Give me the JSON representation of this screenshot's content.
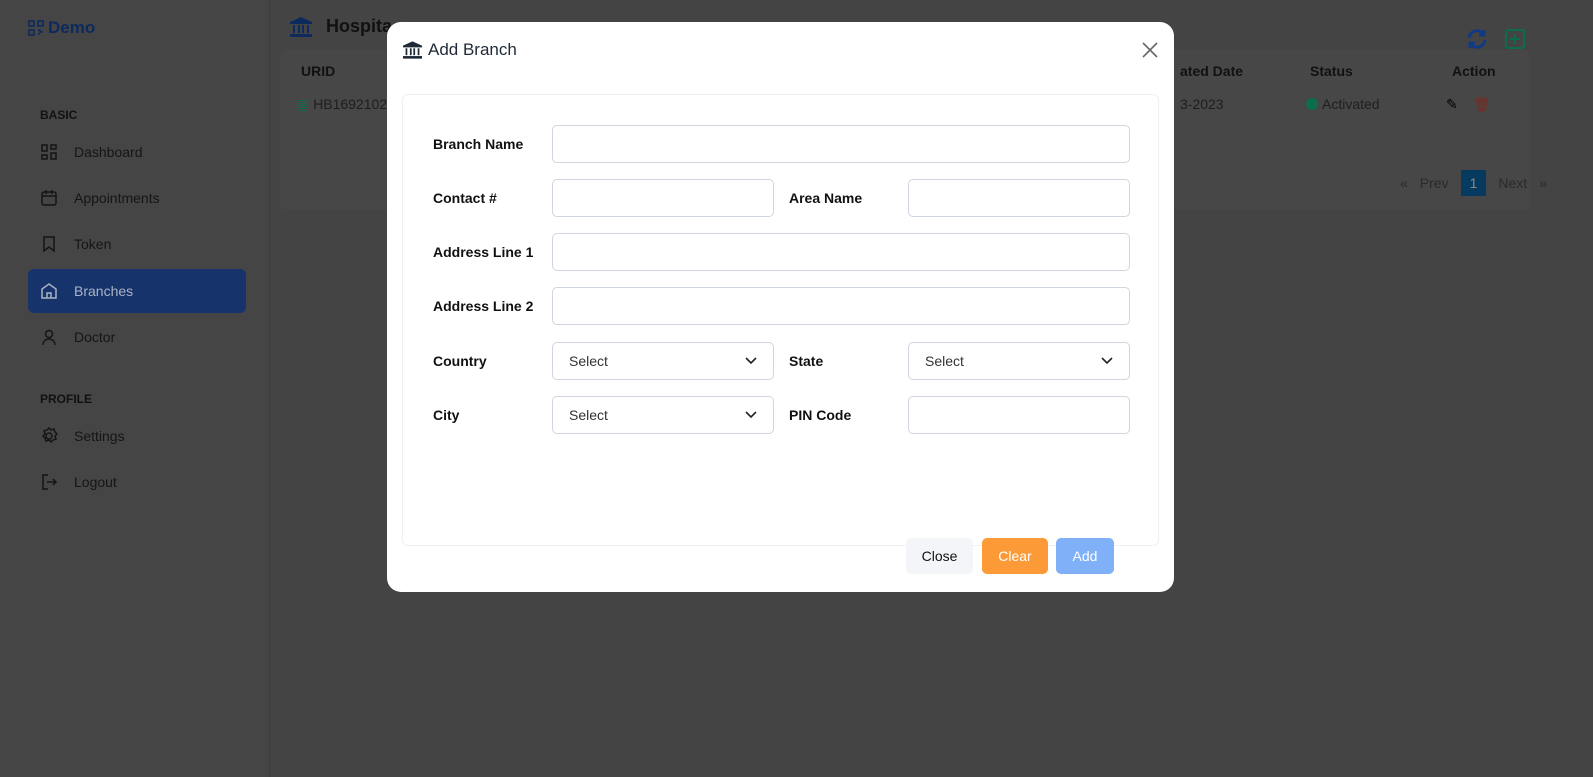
{
  "brand": "Demo",
  "sidebar": {
    "sections": [
      {
        "title": "BASIC"
      },
      {
        "title": "PROFILE"
      }
    ],
    "items": [
      {
        "label": "Dashboard",
        "icon": "dashboard-icon"
      },
      {
        "label": "Appointments",
        "icon": "calendar-icon"
      },
      {
        "label": "Token",
        "icon": "bookmark-icon"
      },
      {
        "label": "Branches",
        "icon": "building-icon",
        "active": true
      },
      {
        "label": "Doctor",
        "icon": "user-icon"
      },
      {
        "label": "Settings",
        "icon": "gear-icon"
      },
      {
        "label": "Logout",
        "icon": "logout-icon"
      }
    ]
  },
  "main": {
    "title": "Hospita",
    "table": {
      "headers": [
        "URID",
        "ated Date",
        "Status",
        "Action"
      ],
      "row": {
        "urid": "HB1692102",
        "date": "3-2023",
        "status": "Activated"
      }
    },
    "pagination": {
      "first": "«",
      "prev": "Prev",
      "page": "1",
      "next": "Next",
      "last": "»"
    }
  },
  "modal": {
    "title": "Add Branch",
    "fields": {
      "branch_name": "Branch Name",
      "contact": "Contact #",
      "area": "Area Name",
      "addr1": "Address Line 1",
      "addr2": "Address Line 2",
      "country": "Country",
      "state": "State",
      "city": "City",
      "pin": "PIN Code"
    },
    "select_placeholder": "Select",
    "buttons": {
      "close": "Close",
      "clear": "Clear",
      "add": "Add"
    }
  },
  "colors": {
    "primary": "#1e4ba8",
    "clear": "#fd9a38",
    "add": "#7fb0f8",
    "activated": "#0a8f63"
  }
}
